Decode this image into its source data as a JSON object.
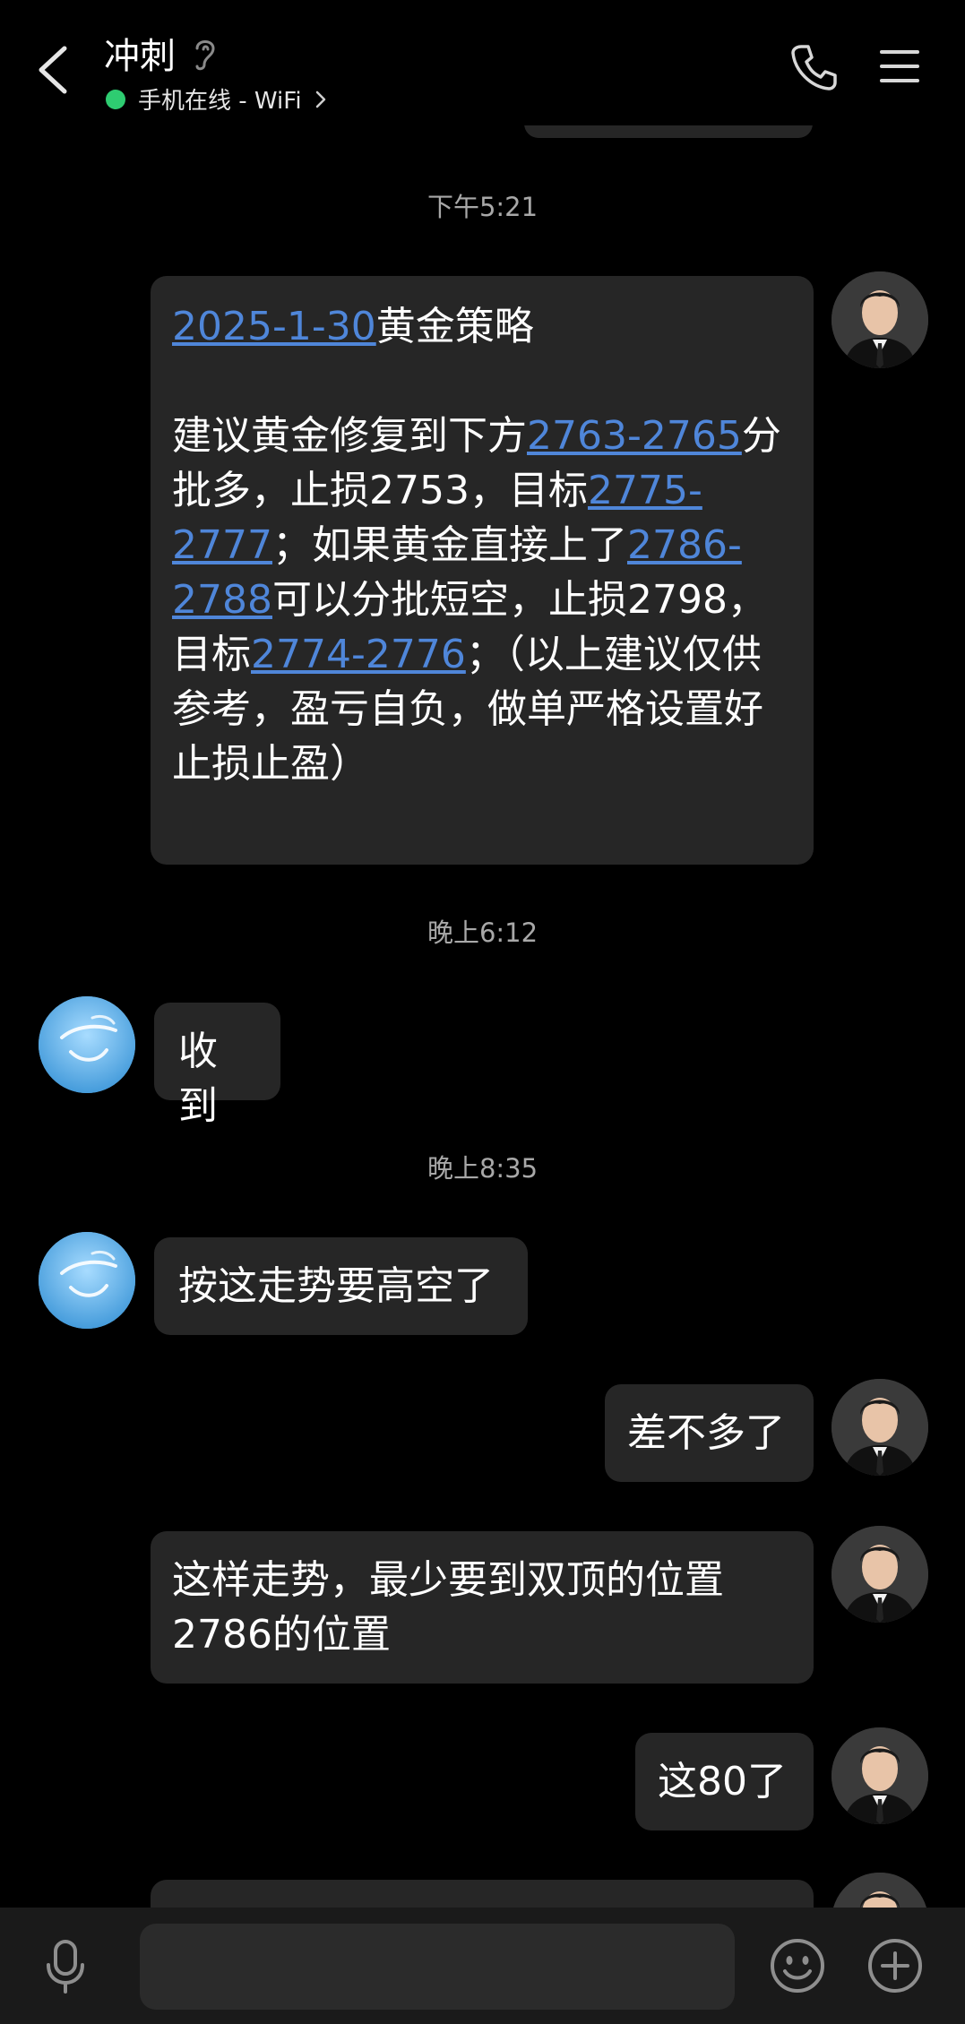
{
  "header": {
    "title": "冲刺",
    "status": "手机在线 - WiFi",
    "status_color": "#2ecc71"
  },
  "colors": {
    "background": "#000000",
    "bubble": "#262626",
    "link": "#4f86d9"
  },
  "messages": {
    "time1": "下午5:21",
    "m1": {
      "date_link": "2025-1-30",
      "title_rest": "黄金策略",
      "t1": "建议黄金修复到下方",
      "l1": "2763-2765",
      "t2": "分批多，止损2753，目标",
      "l2": "2775-2777",
      "t3": "；如果黄金直接上了",
      "l3": "2786-2788",
      "t4": "可以分批短空，止损2798，目标",
      "l4": "2774-2776",
      "t5": "；（以上建议仅供参考，盈亏自负，做单严格设置好止损止盈）"
    },
    "time2": "晚上6:12",
    "m2": "收到",
    "time3": "晚上8:35",
    "m3": "按这走势要高空了",
    "m4": "差不多了",
    "m5_line1": "这样走势，最少要到双顶的位置",
    "m5_line2": "2786的位置",
    "m6": "这80了"
  },
  "input": {
    "icons": [
      "microphone-icon",
      "emoji-icon",
      "plus-icon"
    ]
  }
}
